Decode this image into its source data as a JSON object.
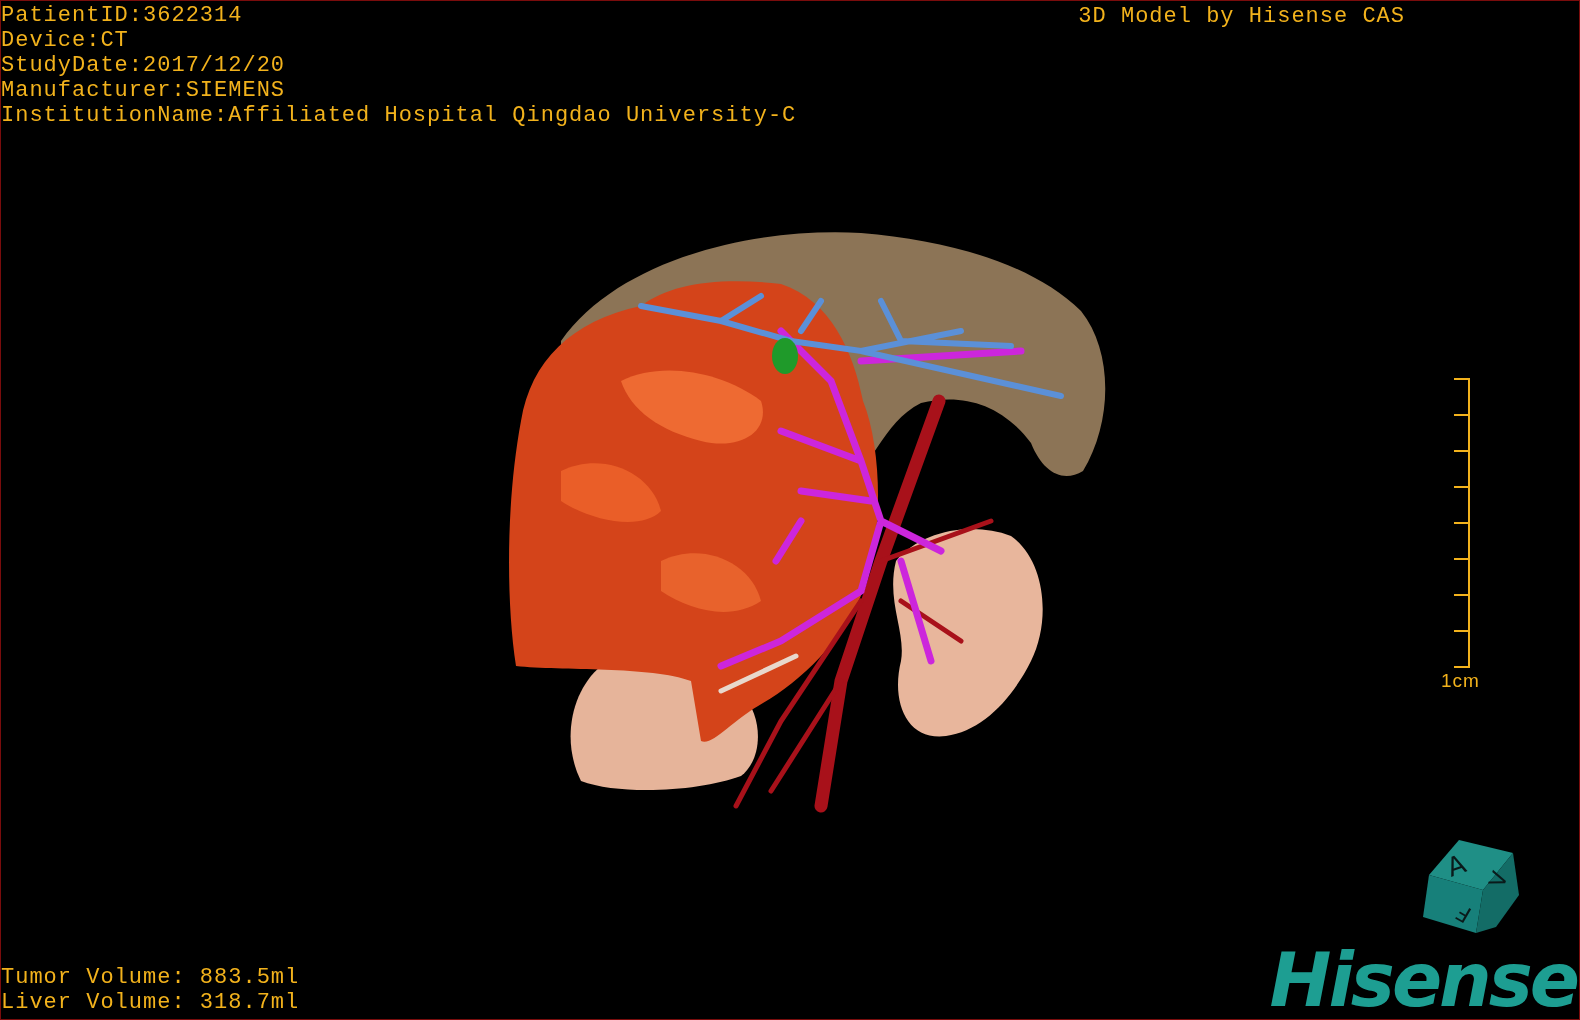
{
  "viewport": {
    "patient_info": [
      "PatientID:3622314",
      "Device:CT",
      "StudyDate:2017/12/20",
      "Manufacturer:SIEMENS",
      "InstitutionName:Affiliated Hospital Qingdao University-C"
    ],
    "title": "3D Model by Hisense CAS",
    "scale_bar": {
      "label": "1cm"
    },
    "volumes": [
      "Tumor Volume: 883.5ml",
      "Liver Volume: 318.7ml"
    ],
    "orientation_cube": {
      "faces": [
        "A",
        "V",
        "F"
      ]
    },
    "logo": "Hisense"
  }
}
